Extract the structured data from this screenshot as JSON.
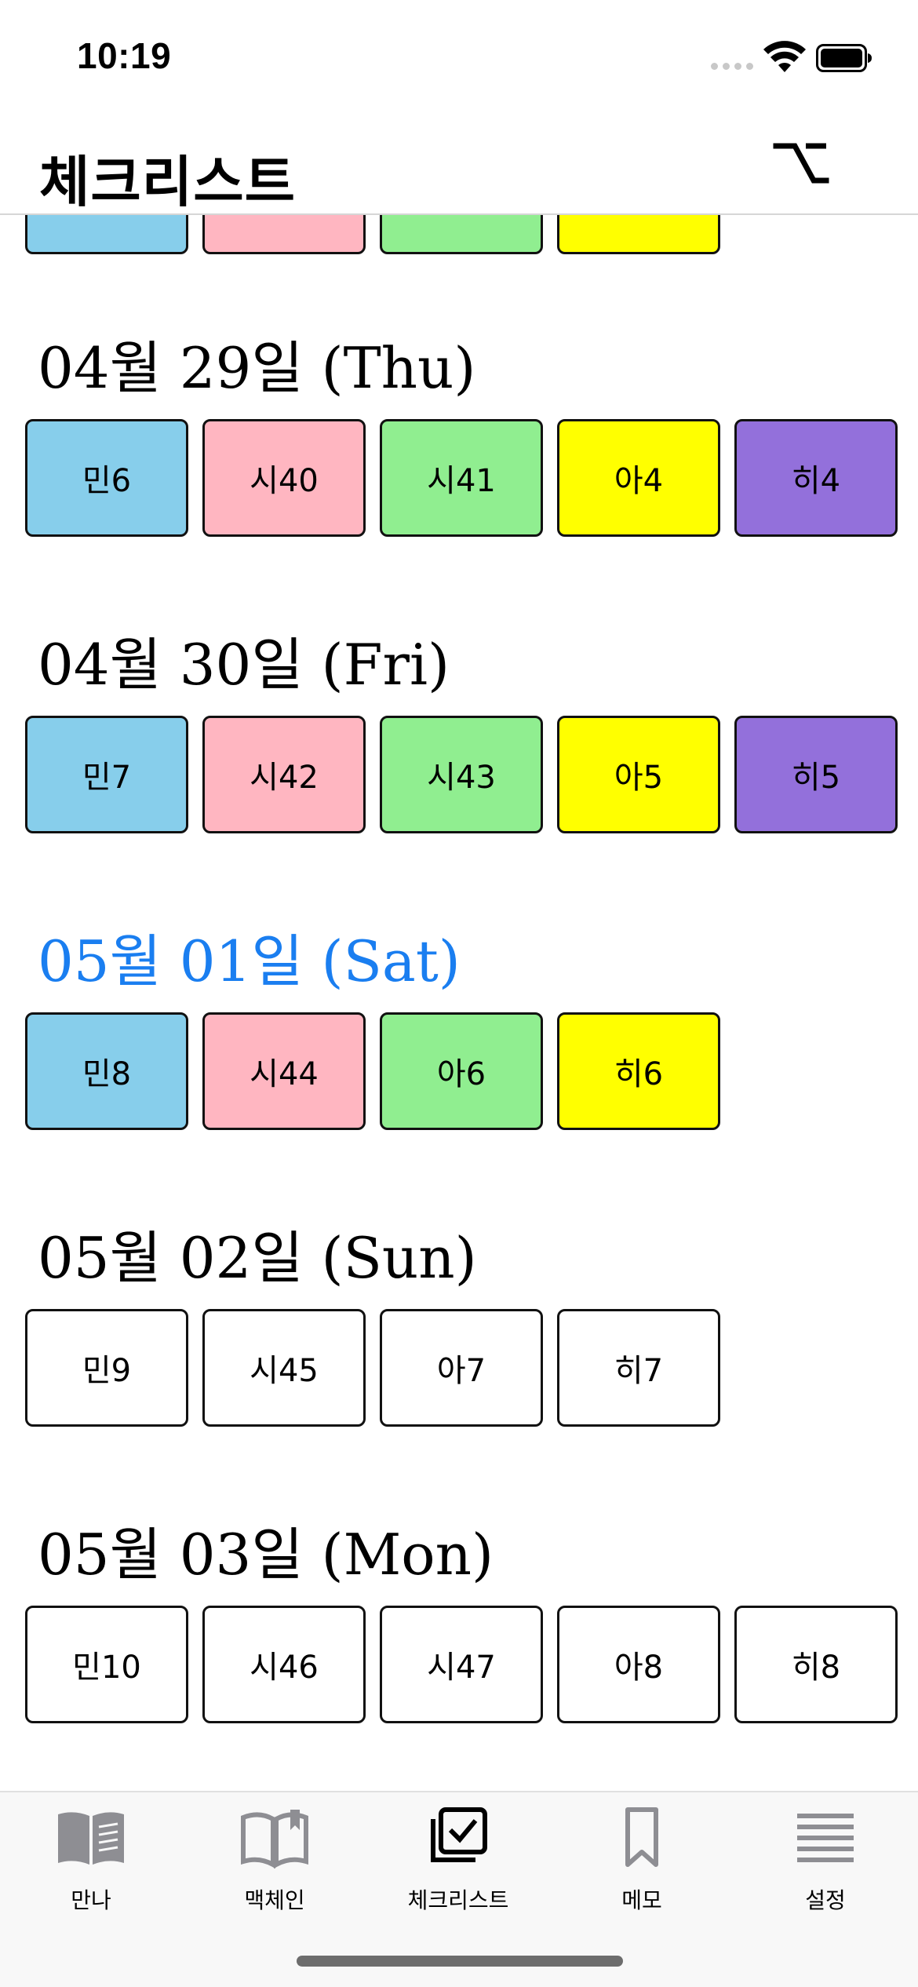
{
  "status_bar": {
    "time": "10:19"
  },
  "nav": {
    "title": "체크리스트",
    "option_icon": "option-key-icon"
  },
  "colors": {
    "blue": "#87ceeb",
    "pink": "#ffb6c1",
    "green": "#90ee90",
    "yellow": "#ffff00",
    "purple": "#9370db",
    "white": "#ffffff",
    "today": "#1a7ef0"
  },
  "days": [
    {
      "date": "",
      "today": false,
      "chips": [
        {
          "label": "",
          "color": "blue"
        },
        {
          "label": "",
          "color": "pink"
        },
        {
          "label": "",
          "color": "green"
        },
        {
          "label": "",
          "color": "yellow"
        }
      ]
    },
    {
      "date": "04월 29일 (Thu)",
      "today": false,
      "chips": [
        {
          "label": "민6",
          "color": "blue"
        },
        {
          "label": "시40",
          "color": "pink"
        },
        {
          "label": "시41",
          "color": "green"
        },
        {
          "label": "아4",
          "color": "yellow"
        },
        {
          "label": "히4",
          "color": "purple"
        }
      ]
    },
    {
      "date": "04월 30일 (Fri)",
      "today": false,
      "chips": [
        {
          "label": "민7",
          "color": "blue"
        },
        {
          "label": "시42",
          "color": "pink"
        },
        {
          "label": "시43",
          "color": "green"
        },
        {
          "label": "아5",
          "color": "yellow"
        },
        {
          "label": "히5",
          "color": "purple"
        }
      ]
    },
    {
      "date": "05월 01일 (Sat)",
      "today": true,
      "chips": [
        {
          "label": "민8",
          "color": "blue"
        },
        {
          "label": "시44",
          "color": "pink"
        },
        {
          "label": "아6",
          "color": "green"
        },
        {
          "label": "히6",
          "color": "yellow"
        }
      ]
    },
    {
      "date": "05월 02일 (Sun)",
      "today": false,
      "chips": [
        {
          "label": "민9",
          "color": "white"
        },
        {
          "label": "시45",
          "color": "white"
        },
        {
          "label": "아7",
          "color": "white"
        },
        {
          "label": "히7",
          "color": "white"
        }
      ]
    },
    {
      "date": "05월 03일 (Mon)",
      "today": false,
      "chips": [
        {
          "label": "민10",
          "color": "white"
        },
        {
          "label": "시46",
          "color": "white"
        },
        {
          "label": "시47",
          "color": "white"
        },
        {
          "label": "아8",
          "color": "white"
        },
        {
          "label": "히8",
          "color": "white"
        }
      ]
    }
  ],
  "tabs": [
    {
      "label": "만나",
      "icon": "open-book-filled-icon",
      "active": false
    },
    {
      "label": "맥체인",
      "icon": "open-book-outline-icon",
      "active": false
    },
    {
      "label": "체크리스트",
      "icon": "checklist-icon",
      "active": true
    },
    {
      "label": "메모",
      "icon": "bookmark-icon",
      "active": false
    },
    {
      "label": "설정",
      "icon": "menu-lines-icon",
      "active": false
    }
  ]
}
